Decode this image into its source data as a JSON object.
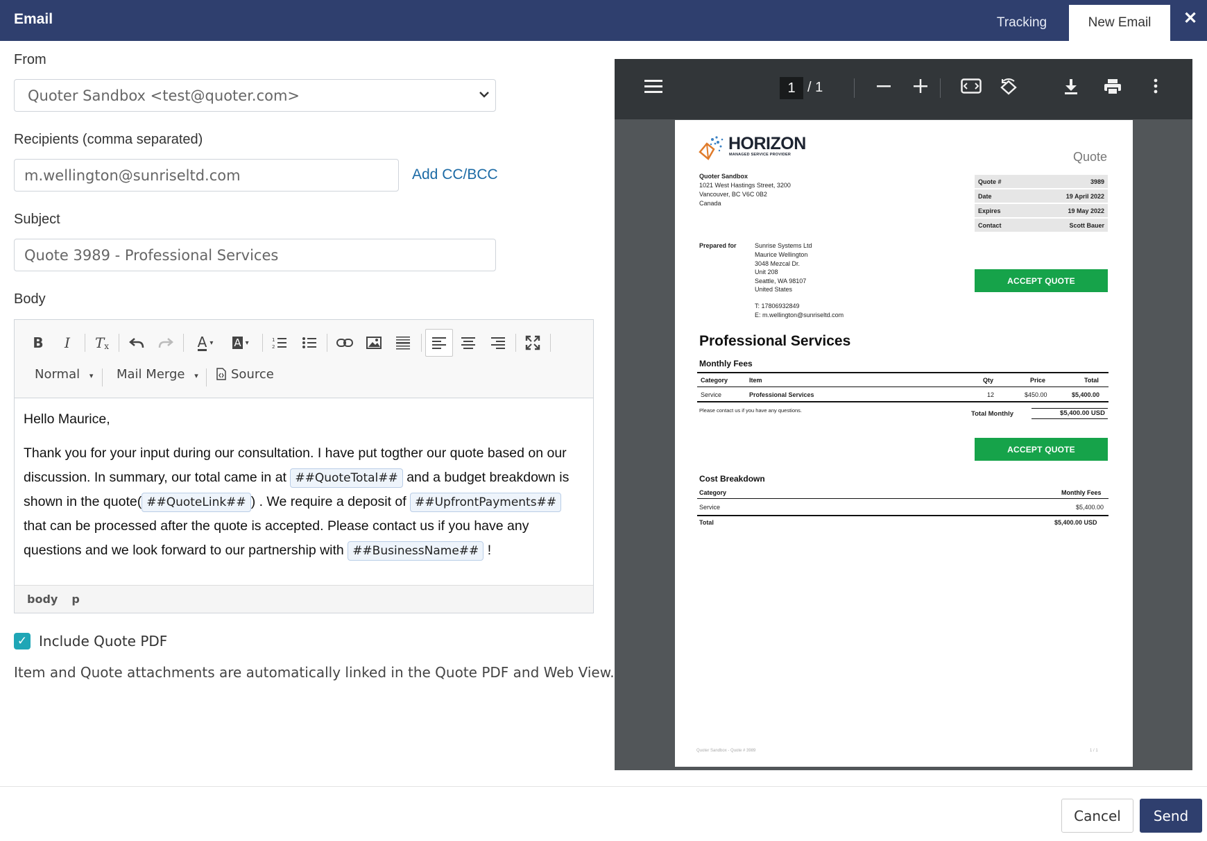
{
  "header": {
    "title": "Email",
    "tabs": [
      {
        "label": "Tracking"
      },
      {
        "label": "New Email"
      }
    ],
    "close_icon": "close-icon",
    "bg_color": "#2f3f6e"
  },
  "form": {
    "from_label": "From",
    "from_value": "Quoter Sandbox <test@quoter.com>",
    "recipients_label": "Recipients (comma separated)",
    "recipients_value": "m.wellington@sunriseltd.com",
    "add_cc_label": "Add CC/BCC",
    "subject_label": "Subject",
    "subject_value": "Quote 3989 - Professional Services",
    "body_label": "Body"
  },
  "editor": {
    "toolbar_row1": [
      "bold-icon",
      "italic-icon",
      "remove-format-icon",
      "undo-icon",
      "redo-icon",
      "text-color-icon",
      "background-color-icon",
      "numbered-list-icon",
      "bulleted-list-icon",
      "link-icon",
      "image-icon",
      "horizontal-line-icon",
      "align-left-icon",
      "align-center-icon",
      "align-right-icon",
      "maximize-icon"
    ],
    "format_select": "Normal",
    "merge_select": "Mail Merge",
    "source_label": "Source",
    "greeting": "Hello Maurice,",
    "p1_a": "Thank you for your input during our consultation. I have put togther our quote based on our discussion. In summary, our total came in at",
    "tag_total": "##QuoteTotal##",
    "p1_b": "and a budget breakdown is shown in the quote(",
    "tag_link": "##QuoteLink##",
    "p1_c": ") . We require a deposit of",
    "tag_upfront": "##UpfrontPayments##",
    "p1_d": "that can be processed after the quote is accepted. Please contact us if you have any questions and we look forward to our partnership with",
    "tag_business": "##BusinessName##",
    "p1_e": "!",
    "path_body": "body",
    "path_p": "p"
  },
  "include_pdf_label": "Include Quote PDF",
  "include_pdf_checked": true,
  "note": "Item and Quote attachments are automatically linked in the Quote PDF and Web View.",
  "viewer": {
    "page_current": "1",
    "page_total": "/  1",
    "icons": [
      "menu-icon",
      "zoom-out-icon",
      "zoom-in-icon",
      "fit-page-icon",
      "rotate-icon",
      "download-icon",
      "print-icon",
      "more-icon"
    ]
  },
  "pdf": {
    "logo_name": "HORIZON",
    "logo_sub": "MANAGED SERVICE PROVIDER",
    "doc_type": "Quote",
    "sender": [
      "Quoter Sandbox",
      "1021 West Hastings Street, 3200",
      "Vancouver, BC V6C 0B2",
      "Canada"
    ],
    "meta": [
      {
        "label": "Quote #",
        "value": "3989"
      },
      {
        "label": "Date",
        "value": "19 April 2022"
      },
      {
        "label": "Expires",
        "value": "19 May 2022"
      },
      {
        "label": "Contact",
        "value": "Scott Bauer"
      }
    ],
    "prepared_for_label": "Prepared for",
    "prepared_for": [
      "Sunrise Systems Ltd",
      "Maurice Wellington",
      "3048 Mezcal Dr.",
      "Unit 208",
      "Seattle, WA 98107",
      "United States"
    ],
    "phone": "T: 17806932849",
    "email": "E: m.wellington@sunriseltd.com",
    "accept_label": "ACCEPT QUOTE",
    "section_title": "Professional Services",
    "monthly_fees_title": "Monthly Fees",
    "columns": [
      "Category",
      "Item",
      "Qty",
      "Price",
      "Total"
    ],
    "row": {
      "category": "Service",
      "item": "Professional Services",
      "qty": "12",
      "price": "$450.00",
      "total": "$5,400.00"
    },
    "contact_note": "Please contact us if you have any questions.",
    "total_monthly_label": "Total Monthly",
    "total_monthly_value": "$5,400.00 USD",
    "cost_breakdown_title": "Cost Breakdown",
    "cb_columns": [
      "Category",
      "Monthly Fees"
    ],
    "cb_row": {
      "category": "Service",
      "value": "$5,400.00"
    },
    "cb_total": {
      "label": "Total",
      "value": "$5,400.00 USD"
    },
    "footer_left": "Quoter Sandbox - Quote # 3989",
    "footer_right": "1 / 1"
  },
  "actions": {
    "cancel": "Cancel",
    "send": "Send"
  }
}
